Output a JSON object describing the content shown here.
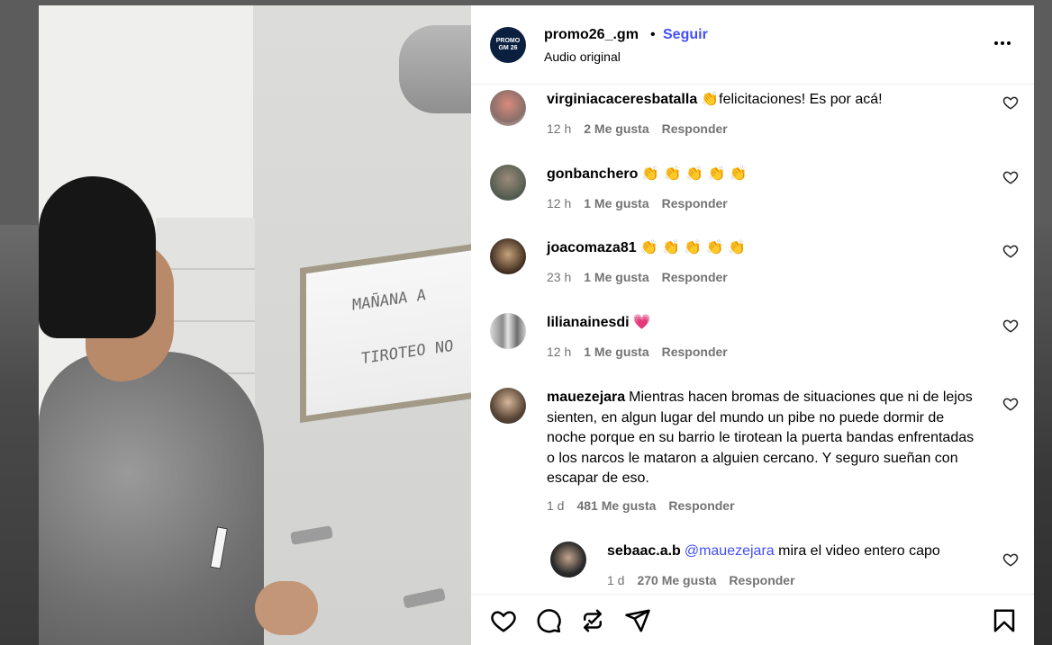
{
  "header": {
    "username": "promo26_.gm",
    "separator": "•",
    "follow_label": "Seguir",
    "subtitle": "Audio original",
    "avatar_text": "PROMO GM 26"
  },
  "media": {
    "mirror_line1": "MAÑANA A",
    "mirror_line2": "TIROTEO NO"
  },
  "comments": [
    {
      "username": "virginiacaceresbatalla",
      "text": "👏felicitaciones! Es por acá!",
      "time": "12 h",
      "likes": "2 Me gusta",
      "reply": "Responder"
    },
    {
      "username": "gonbanchero",
      "text": "👏 👏 👏 👏 👏",
      "time": "12 h",
      "likes": "1 Me gusta",
      "reply": "Responder"
    },
    {
      "username": "joacomaza81",
      "text": "👏 👏 👏 👏 👏",
      "time": "23 h",
      "likes": "1 Me gusta",
      "reply": "Responder"
    },
    {
      "username": "lilianainesdi",
      "text": "💗",
      "time": "12 h",
      "likes": "1 Me gusta",
      "reply": "Responder"
    },
    {
      "username": "mauezejara",
      "text": "Mientras hacen bromas de situaciones que ni de lejos sienten, en algun lugar del mundo un pibe no puede dormir de noche porque en su barrio le tirotean la puerta bandas enfrentadas o los narcos le mataron a alguien cercano. Y seguro sueñan con escapar de eso.",
      "time": "1 d",
      "likes": "481 Me gusta",
      "reply": "Responder"
    },
    {
      "username": "sebaac.a.b",
      "mention": "@mauezejara",
      "text": " mira el video entero capo",
      "time": "1 d",
      "likes": "270 Me gusta",
      "reply": "Responder"
    }
  ],
  "icons": {
    "more": "more-options-icon",
    "heart": "heart-icon",
    "comment": "comment-icon",
    "repost": "repost-icon",
    "share": "send-icon",
    "save": "bookmark-icon"
  },
  "colors": {
    "link_blue": "#4150f7",
    "meta_gray": "#737373",
    "heart_pink": "#e8336f"
  }
}
